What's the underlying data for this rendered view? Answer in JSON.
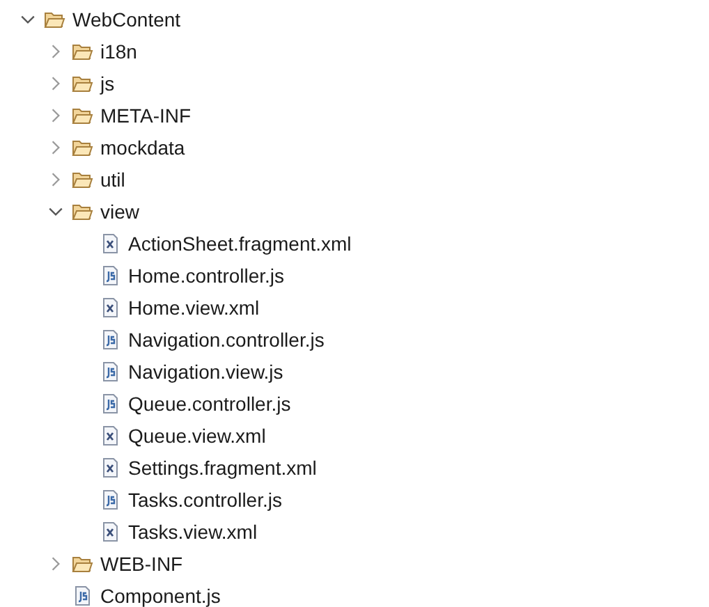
{
  "tree": [
    {
      "label": "WebContent",
      "kind": "folder",
      "expanded": true,
      "children": [
        {
          "label": "i18n",
          "kind": "folder",
          "expanded": false
        },
        {
          "label": "js",
          "kind": "folder",
          "expanded": false
        },
        {
          "label": "META-INF",
          "kind": "folder",
          "expanded": false
        },
        {
          "label": "mockdata",
          "kind": "folder",
          "expanded": false
        },
        {
          "label": "util",
          "kind": "folder",
          "expanded": false
        },
        {
          "label": "view",
          "kind": "folder",
          "expanded": true,
          "children": [
            {
              "label": "ActionSheet.fragment.xml",
              "kind": "xml-file"
            },
            {
              "label": "Home.controller.js",
              "kind": "js-file"
            },
            {
              "label": "Home.view.xml",
              "kind": "xml-file"
            },
            {
              "label": "Navigation.controller.js",
              "kind": "js-file"
            },
            {
              "label": "Navigation.view.js",
              "kind": "js-file"
            },
            {
              "label": "Queue.controller.js",
              "kind": "js-file"
            },
            {
              "label": "Queue.view.xml",
              "kind": "xml-file"
            },
            {
              "label": "Settings.fragment.xml",
              "kind": "xml-file"
            },
            {
              "label": "Tasks.controller.js",
              "kind": "js-file"
            },
            {
              "label": "Tasks.view.xml",
              "kind": "xml-file"
            }
          ]
        },
        {
          "label": "WEB-INF",
          "kind": "folder",
          "expanded": false
        },
        {
          "label": "Component.js",
          "kind": "js-file"
        }
      ]
    }
  ]
}
